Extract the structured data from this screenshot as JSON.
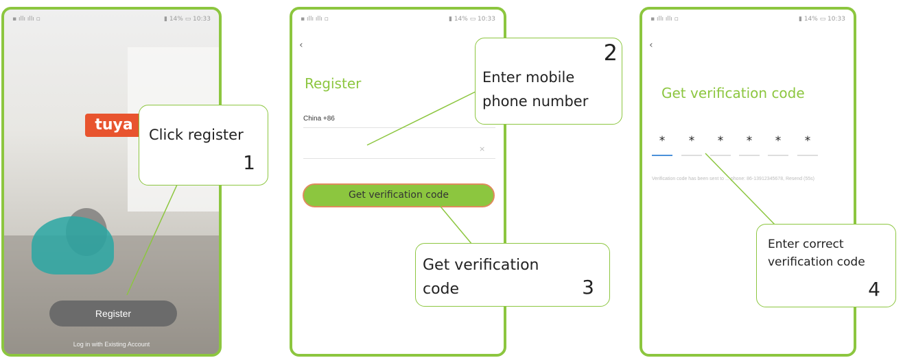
{
  "steps": [
    {
      "status": {
        "left": "▪ ıllı ıllı ▫",
        "right": "▮ 14% ▭ 10:33"
      },
      "logo": "tuya",
      "register_button": "Register",
      "login_link": "Log in with Existing Account",
      "callout": {
        "text": "Click register",
        "number": "1"
      }
    },
    {
      "status": {
        "left": "▪ ıllı ıllı ▫",
        "right": "▮ 14% ▭ 10:33"
      },
      "title": "Register",
      "country": "China +86",
      "get_code_button": "Get verification code",
      "callout_phone": {
        "text": "Enter mobile phone number",
        "number": "2"
      },
      "callout_code": {
        "text": "Get verification code",
        "number": "3"
      }
    },
    {
      "status": {
        "left": "▪ ıllı ıllı ▫",
        "right": "▮ 14% ▭ 10:33"
      },
      "title": "Get verification code",
      "digits": [
        "*",
        "*",
        "*",
        "*",
        "*",
        "*"
      ],
      "note": "Verification code has been sent to ... phone: 86-13912345678, Resend (55s)",
      "callout": {
        "text": "Enter correct verification code",
        "number": "4"
      }
    }
  ],
  "colors": {
    "accent_green": "#8cc63f",
    "brand_red": "#e8542e",
    "button_gray": "#6b6b6b",
    "active_underline": "#4a90d9"
  }
}
